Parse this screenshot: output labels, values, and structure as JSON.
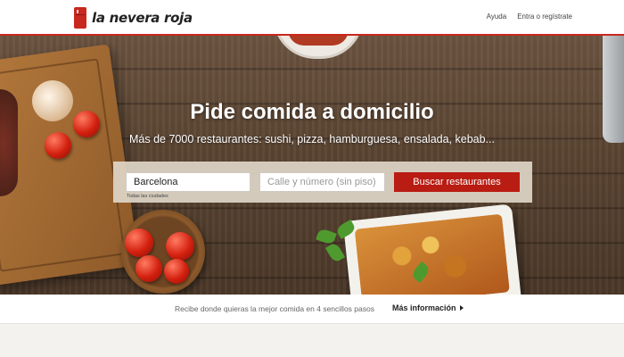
{
  "header": {
    "logo_text": "la nevera roja",
    "nav": {
      "help": "Ayuda",
      "login": "Entra o regístrate"
    }
  },
  "hero": {
    "title": "Pide comida a domicilio",
    "subtitle": "Más de 7000 restaurantes: sushi, pizza, hamburguesa, ensalada, kebab..."
  },
  "search": {
    "city_value": "Barcelona",
    "street_placeholder": "Calle y número (sin piso)",
    "button_label": "Buscar restaurantes",
    "all_cities_link": "Todas las ciudades"
  },
  "info": {
    "text": "Recibe donde quieras la mejor comida en 4 sencillos pasos",
    "link": "Más información"
  },
  "colors": {
    "brand_red": "#c8281e",
    "button_red": "#b81c12"
  },
  "icons": [
    "fridge-logo-icon",
    "arrow-right-icon"
  ]
}
